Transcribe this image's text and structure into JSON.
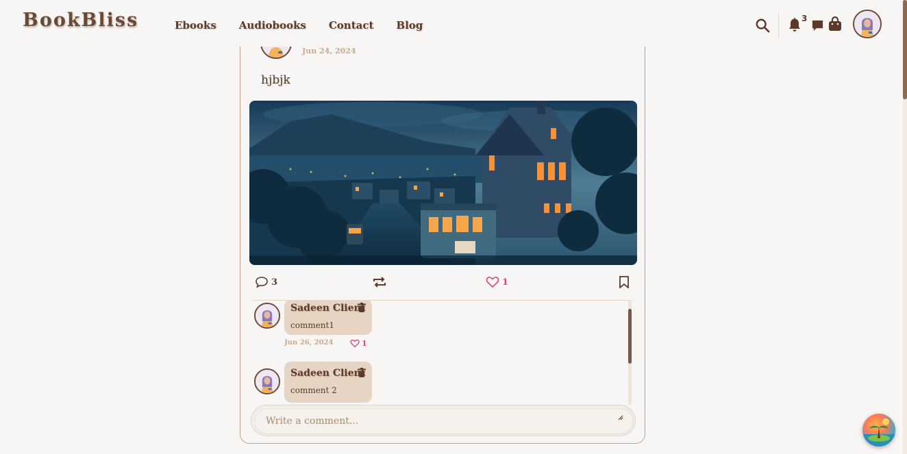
{
  "brand": "BookBliss",
  "nav": {
    "ebooks": "Ebooks",
    "audiobooks": "Audiobooks",
    "contact": "Contact",
    "blog": "Blog"
  },
  "header": {
    "notification_count": "3",
    "icons": [
      "search-icon",
      "bell-icon",
      "chat-icon",
      "shopping-bag-icon",
      "user-avatar"
    ]
  },
  "post": {
    "date": "Jun 24, 2024",
    "text": "hjbjk",
    "comment_count": "3",
    "like_count": "1"
  },
  "comments": [
    {
      "author": "Sadeen Client",
      "text": "comment1",
      "date": "Jun 26, 2024",
      "likes": "1"
    },
    {
      "author": "Sadeen Client",
      "text": "comment 2"
    }
  ],
  "comment_input": {
    "placeholder": "Write a comment..."
  },
  "colors": {
    "brand": "#6b4a35",
    "text": "#5b3a29",
    "like": "#e0487a",
    "bubble": "#e6d5c4",
    "border": "#c89f7d"
  }
}
